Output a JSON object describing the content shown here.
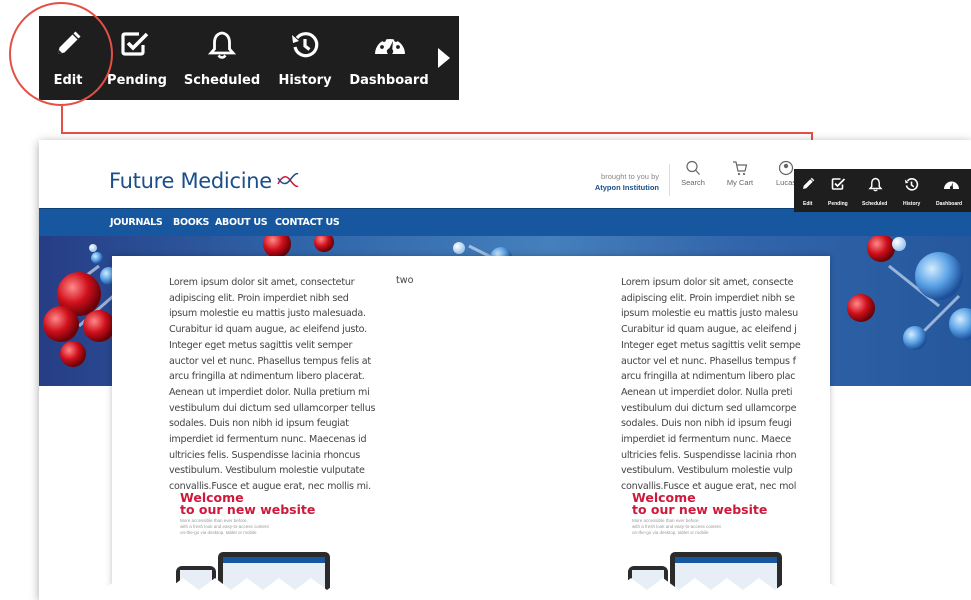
{
  "toolbar": {
    "items": [
      {
        "label": "Edit",
        "icon": "pencil-icon"
      },
      {
        "label": "Pending",
        "icon": "checkbox-icon"
      },
      {
        "label": "Scheduled",
        "icon": "bell-icon"
      },
      {
        "label": "History",
        "icon": "history-icon"
      },
      {
        "label": "Dashboard",
        "icon": "dashboard-icon"
      }
    ],
    "more_icon": "play-arrow-icon",
    "highlighted": "Edit"
  },
  "site": {
    "logo_text": "Future Medicine",
    "brought_by_label": "brought to you by",
    "institution": "Atypon Institution",
    "header_actions": [
      {
        "label": "Search",
        "icon": "search-icon"
      },
      {
        "label": "My Cart",
        "icon": "cart-icon"
      },
      {
        "label": "Lucas",
        "icon": "user-icon"
      }
    ],
    "nav": [
      "JOURNALS",
      "BOOKS",
      "ABOUT US",
      "CONTACT US"
    ],
    "column_two_label": "two",
    "lorem_left": "Lorem ipsum dolor sit amet, consectetur\nadipiscing elit. Proin imperdiet nibh sed\nipsum molestie eu mattis justo malesuada.\nCurabitur id quam augue, ac eleifend justo.\nInteger eget metus sagittis velit semper\nauctor vel et nunc. Phasellus tempus felis at\narcu fringilla at ndimentum libero placerat.\nAenean ut imperdiet dolor. Nulla pretium mi\nvestibulum dui dictum sed ullamcorper tellus\nsodales. Duis non nibh id ipsum feugiat\nimperdiet id fermentum nunc. Maecenas id\nultricies felis. Suspendisse lacinia rhoncus\nvestibulum. Vestibulum molestie vulputate\nconvallis.Fusce et augue erat, nec mollis mi.",
    "lorem_right": "Lorem ipsum dolor sit amet, consecte\nadipiscing elit. Proin imperdiet nibh se\nipsum molestie eu mattis justo malesu\nCurabitur id quam augue, ac eleifend j\nInteger eget metus sagittis velit sempe\nauctor vel et nunc. Phasellus tempus f\narcu fringilla at ndimentum libero plac\nAenean ut imperdiet dolor. Nulla preti\nvestibulum dui dictum sed ullamcorpe\nsodales. Duis non nibh id ipsum feugi\nimperdiet id fermentum nunc. Maece\nultricies felis. Suspendisse lacinia rhon\nvestibulum. Vestibulum molestie vulp\nconvallis.Fusce et augue erat, nec mol",
    "welcome_line1": "Welcome",
    "welcome_line2": "to our new website",
    "welcome_small": "More accessible than ever before,\nwith a fresh look and easy-to-access content\non-the-go via desktop, tablet or mobile"
  },
  "colors": {
    "toolbar_bg": "#1e1e1e",
    "highlight": "#e45045",
    "nav_bg": "#1657a0",
    "logo": "#1a4f8a",
    "welcome": "#d0183a"
  }
}
